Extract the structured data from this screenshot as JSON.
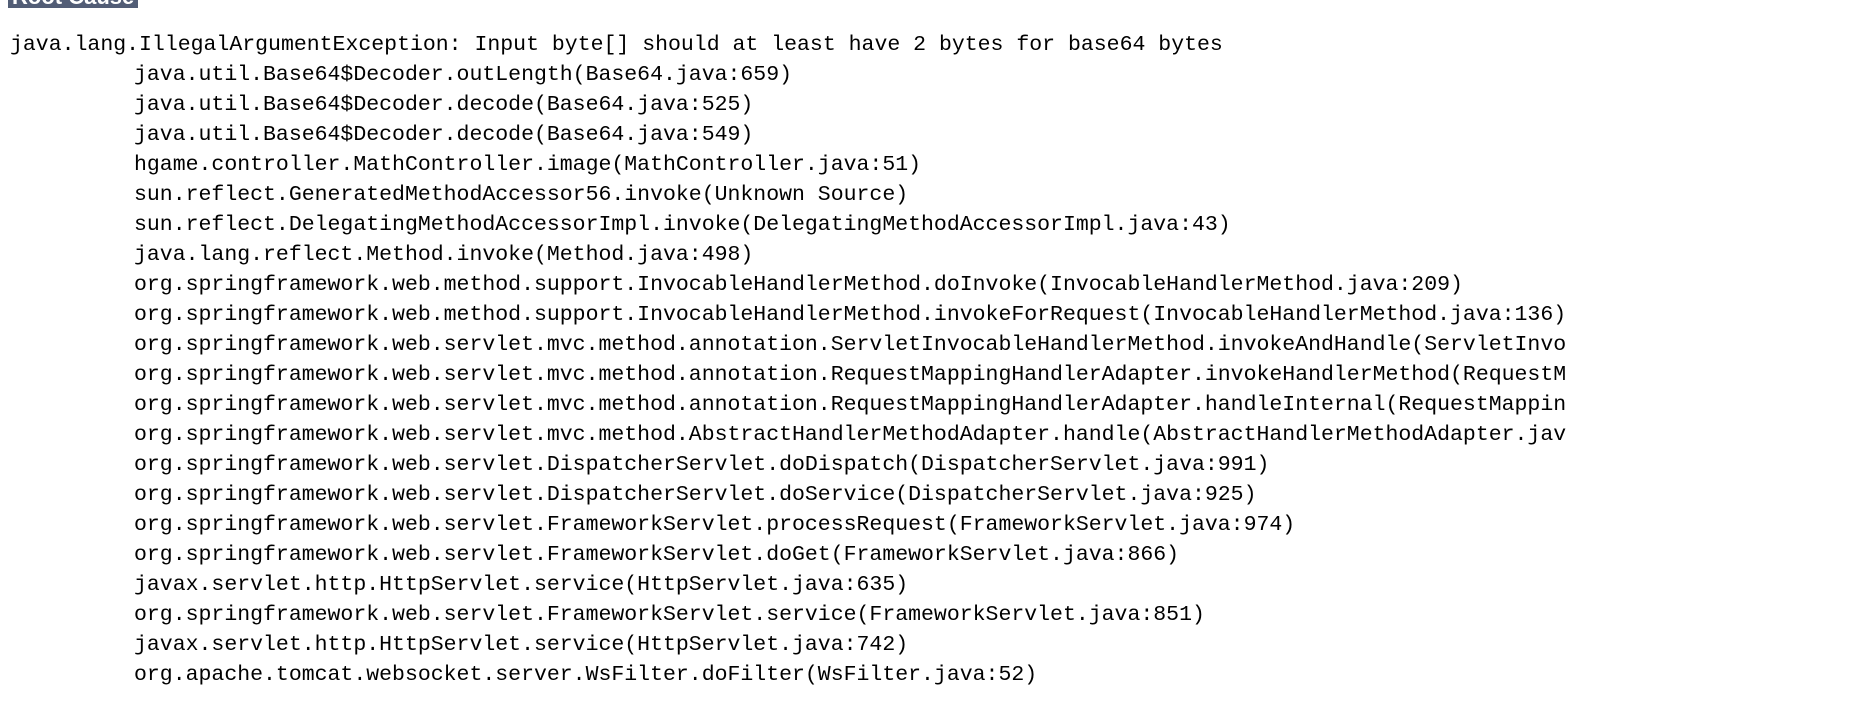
{
  "heading": "Root Cause",
  "exception": "java.lang.IllegalArgumentException: Input byte[] should at least have 2 bytes for base64 bytes",
  "frames": [
    "java.util.Base64$Decoder.outLength(Base64.java:659)",
    "java.util.Base64$Decoder.decode(Base64.java:525)",
    "java.util.Base64$Decoder.decode(Base64.java:549)",
    "hgame.controller.MathController.image(MathController.java:51)",
    "sun.reflect.GeneratedMethodAccessor56.invoke(Unknown Source)",
    "sun.reflect.DelegatingMethodAccessorImpl.invoke(DelegatingMethodAccessorImpl.java:43)",
    "java.lang.reflect.Method.invoke(Method.java:498)",
    "org.springframework.web.method.support.InvocableHandlerMethod.doInvoke(InvocableHandlerMethod.java:209)",
    "org.springframework.web.method.support.InvocableHandlerMethod.invokeForRequest(InvocableHandlerMethod.java:136)",
    "org.springframework.web.servlet.mvc.method.annotation.ServletInvocableHandlerMethod.invokeAndHandle(ServletInvo",
    "org.springframework.web.servlet.mvc.method.annotation.RequestMappingHandlerAdapter.invokeHandlerMethod(RequestM",
    "org.springframework.web.servlet.mvc.method.annotation.RequestMappingHandlerAdapter.handleInternal(RequestMappin",
    "org.springframework.web.servlet.mvc.method.AbstractHandlerMethodAdapter.handle(AbstractHandlerMethodAdapter.jav",
    "org.springframework.web.servlet.DispatcherServlet.doDispatch(DispatcherServlet.java:991)",
    "org.springframework.web.servlet.DispatcherServlet.doService(DispatcherServlet.java:925)",
    "org.springframework.web.servlet.FrameworkServlet.processRequest(FrameworkServlet.java:974)",
    "org.springframework.web.servlet.FrameworkServlet.doGet(FrameworkServlet.java:866)",
    "javax.servlet.http.HttpServlet.service(HttpServlet.java:635)",
    "org.springframework.web.servlet.FrameworkServlet.service(FrameworkServlet.java:851)",
    "javax.servlet.http.HttpServlet.service(HttpServlet.java:742)",
    "org.apache.tomcat.websocket.server.WsFilter.doFilter(WsFilter.java:52)"
  ],
  "colors": {
    "heading_bg": "#525d76",
    "heading_text": "#ffffff",
    "text": "#000000",
    "background": "#ffffff"
  }
}
